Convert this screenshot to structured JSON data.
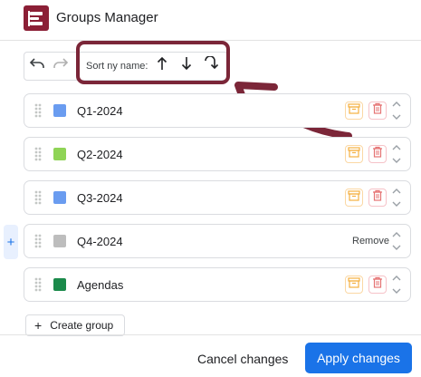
{
  "app": {
    "title": "Groups Manager",
    "logo_color": "#8b1f36"
  },
  "toolbar": {
    "sort_label": "Sort ny name:",
    "undo_icon": "undo-icon",
    "redo_icon": "redo-icon",
    "sort_asc_icon": "arrow-up-icon",
    "sort_desc_icon": "arrow-down-icon",
    "sort_reset_icon": "redo-arrow-icon"
  },
  "groups": [
    {
      "name": "Q1-2024",
      "color": "#6a9cf0",
      "actions": "icons"
    },
    {
      "name": "Q2-2024",
      "color": "#8fd456",
      "actions": "icons"
    },
    {
      "name": "Q3-2024",
      "color": "#6a9cf0",
      "actions": "icons"
    },
    {
      "name": "Q4-2024",
      "color": "#bdbdbd",
      "actions": "remove",
      "remove_label": "Remove"
    },
    {
      "name": "Agendas",
      "color": "#1b8a4b",
      "actions": "icons"
    }
  ],
  "create_group": {
    "label": "Create group"
  },
  "footer": {
    "cancel_label": "Cancel changes",
    "apply_label": "Apply changes"
  },
  "colors": {
    "accent": "#1a73e8",
    "annotation": "#7b2638",
    "archive": "#f5b041",
    "delete": "#e57373"
  }
}
